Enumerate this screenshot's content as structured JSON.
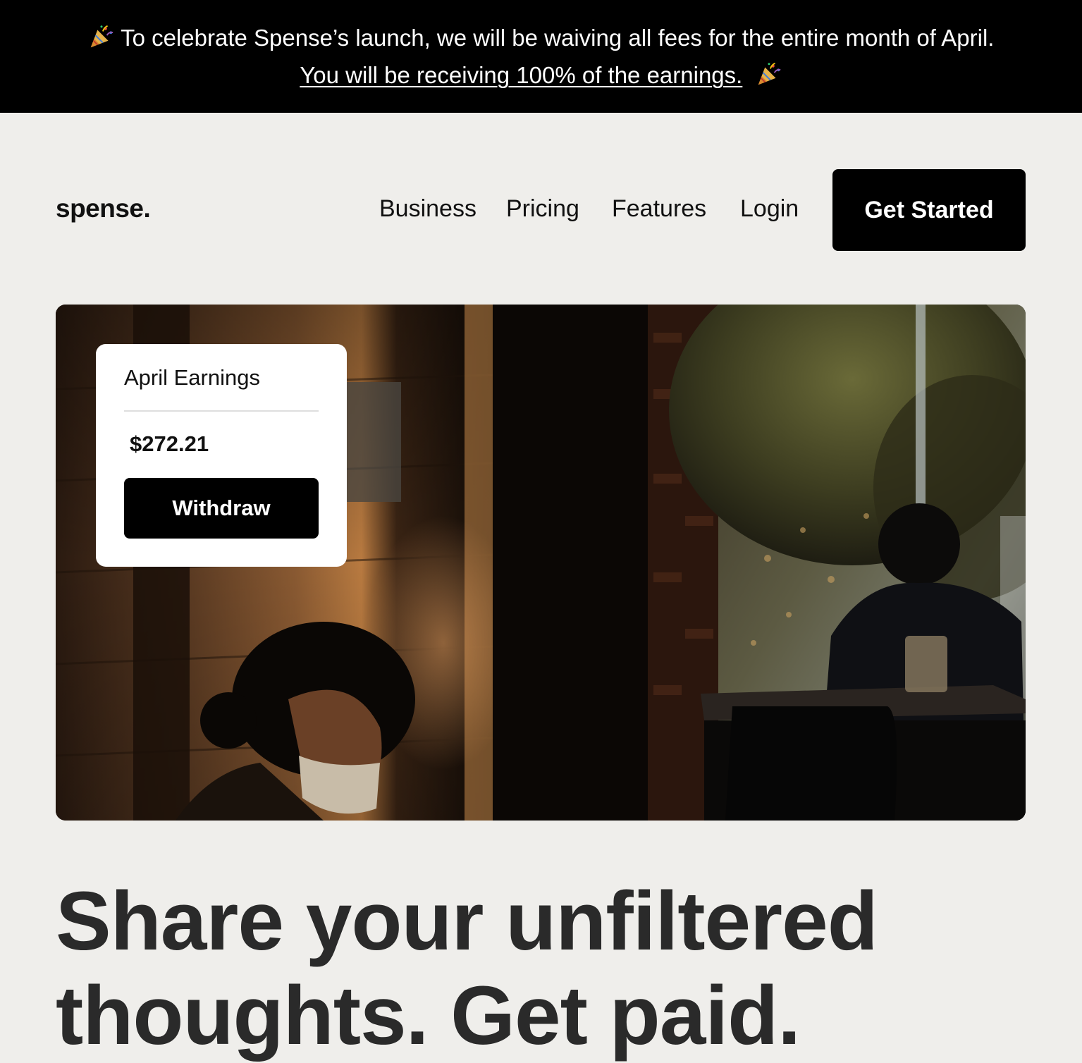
{
  "announcement": {
    "line1": "To celebrate Spense’s launch, we will be waiving all fees for the entire month of April.",
    "link_text": "You will be receiving 100% of the earnings.",
    "icon": "party-popper-icon"
  },
  "nav": {
    "logo": "spense.",
    "links": [
      "Business",
      "Pricing",
      "Features",
      "Login"
    ],
    "cta": "Get Started"
  },
  "earnings_card": {
    "title": "April Earnings",
    "amount": "$272.21",
    "button": "Withdraw"
  },
  "hero": {
    "headline_line1": "Share your unfiltered",
    "headline_line2": "thoughts. Get paid."
  },
  "colors": {
    "page_background": "#efeeeb",
    "announcement_background": "#000000",
    "button_background": "#000000",
    "headline_color": "#2a2a2a"
  }
}
